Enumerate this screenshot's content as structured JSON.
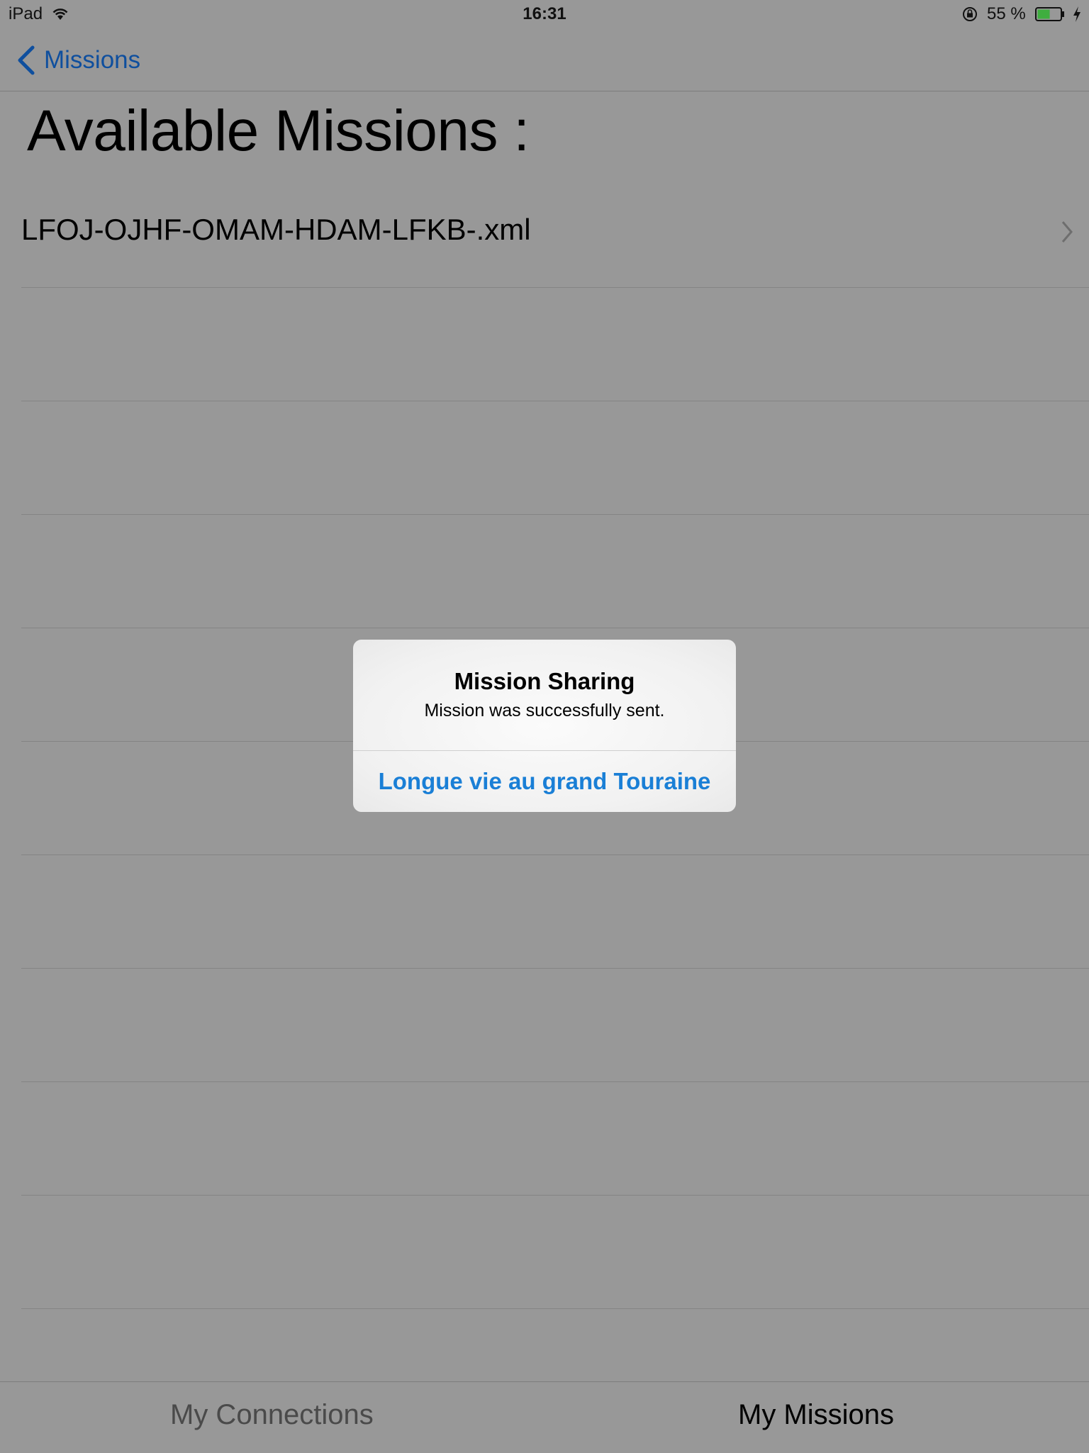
{
  "status_bar": {
    "device": "iPad",
    "time": "16:31",
    "battery_percent": "55 %",
    "battery_level": 0.55,
    "icons": [
      "wifi-icon",
      "rotation-lock-icon",
      "battery-icon",
      "charging-bolt-icon"
    ]
  },
  "nav": {
    "back_label": "Missions"
  },
  "page": {
    "title": "Available Missions :"
  },
  "missions": [
    {
      "name": "LFOJ-OJHF-OMAM-HDAM-LFKB-.xml"
    },
    {
      "name": ""
    },
    {
      "name": ""
    },
    {
      "name": ""
    },
    {
      "name": ""
    },
    {
      "name": ""
    },
    {
      "name": ""
    },
    {
      "name": ""
    },
    {
      "name": ""
    },
    {
      "name": ""
    }
  ],
  "alert": {
    "title": "Mission Sharing",
    "message": "Mission was successfully sent.",
    "button_label": "Longue vie au grand Touraine"
  },
  "tabs": {
    "connections_label": "My Connections",
    "missions_label": "My Missions",
    "selected": "My Missions"
  },
  "colors": {
    "background": "#989898",
    "accent": "#1a7fd6",
    "nav_link": "#0f4f9e",
    "battery": "#3fae3f"
  }
}
